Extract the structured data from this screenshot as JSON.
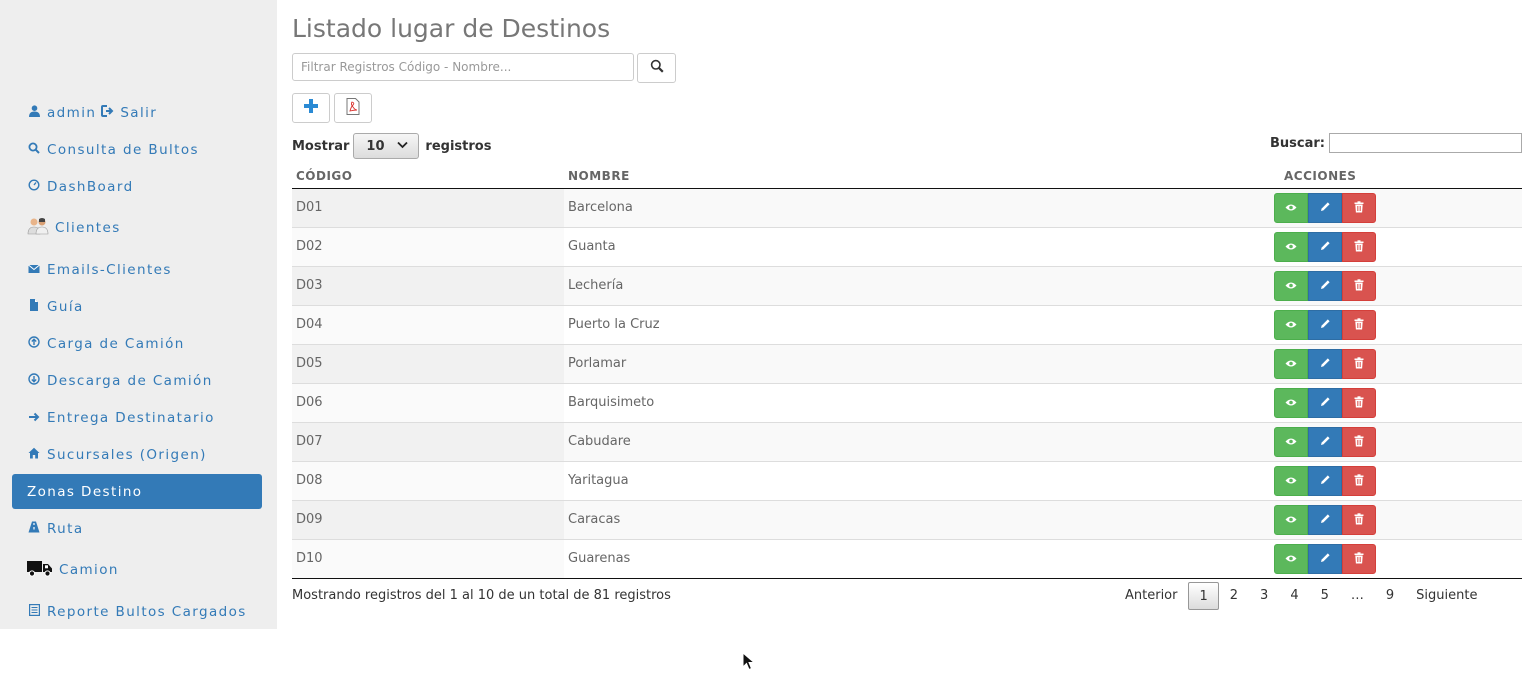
{
  "sidebar": {
    "user": "admin",
    "logout": "Salir",
    "items": [
      {
        "label": "Consulta de Bultos",
        "icon": "search-icon"
      },
      {
        "label": "DashBoard",
        "icon": "dashboard-icon"
      },
      {
        "label": "Clientes",
        "icon": "users-icon"
      },
      {
        "label": "Emails-Clientes",
        "icon": "envelope-icon"
      },
      {
        "label": "Guía",
        "icon": "file-icon"
      },
      {
        "label": "Carga de Camión",
        "icon": "upload-circle-icon"
      },
      {
        "label": "Descarga de Camión",
        "icon": "download-circle-icon"
      },
      {
        "label": "Entrega Destinatario",
        "icon": "arrow-right-icon"
      },
      {
        "label": "Sucursales (Origen)",
        "icon": "home-icon"
      },
      {
        "label": "Zonas Destino",
        "icon": "",
        "active": true
      },
      {
        "label": "Ruta",
        "icon": "road-icon"
      },
      {
        "label": "Camion",
        "icon": "truck-icon"
      },
      {
        "label": "Reporte Bultos Cargados",
        "icon": "list-icon"
      }
    ]
  },
  "main": {
    "title": "Listado lugar de Destinos",
    "filter_placeholder": "Filtrar Registros Código - Nombre...",
    "length_label_before": "Mostrar",
    "length_value": "10",
    "length_label_after": "registros",
    "search_label": "Buscar:",
    "columns": [
      "CÓDIGO",
      "NOMBRE",
      "ACCIONES"
    ],
    "rows": [
      {
        "code": "D01",
        "name": "Barcelona"
      },
      {
        "code": "D02",
        "name": "Guanta"
      },
      {
        "code": "D03",
        "name": "Lechería"
      },
      {
        "code": "D04",
        "name": "Puerto la Cruz"
      },
      {
        "code": "D05",
        "name": "Porlamar"
      },
      {
        "code": "D06",
        "name": "Barquisimeto"
      },
      {
        "code": "D07",
        "name": "Cabudare"
      },
      {
        "code": "D08",
        "name": "Yaritagua"
      },
      {
        "code": "D09",
        "name": "Caracas"
      },
      {
        "code": "D10",
        "name": "Guarenas"
      }
    ],
    "info": "Mostrando registros del 1 al 10 de un total de 81 registros",
    "pagination": {
      "prev": "Anterior",
      "pages": [
        "1",
        "2",
        "3",
        "4",
        "5",
        "…",
        "9"
      ],
      "current": "1",
      "next": "Siguiente"
    }
  },
  "colors": {
    "primary": "#337ab7",
    "success": "#5cb85c",
    "danger": "#d9534f",
    "sidebar_bg": "#eeeeee"
  }
}
